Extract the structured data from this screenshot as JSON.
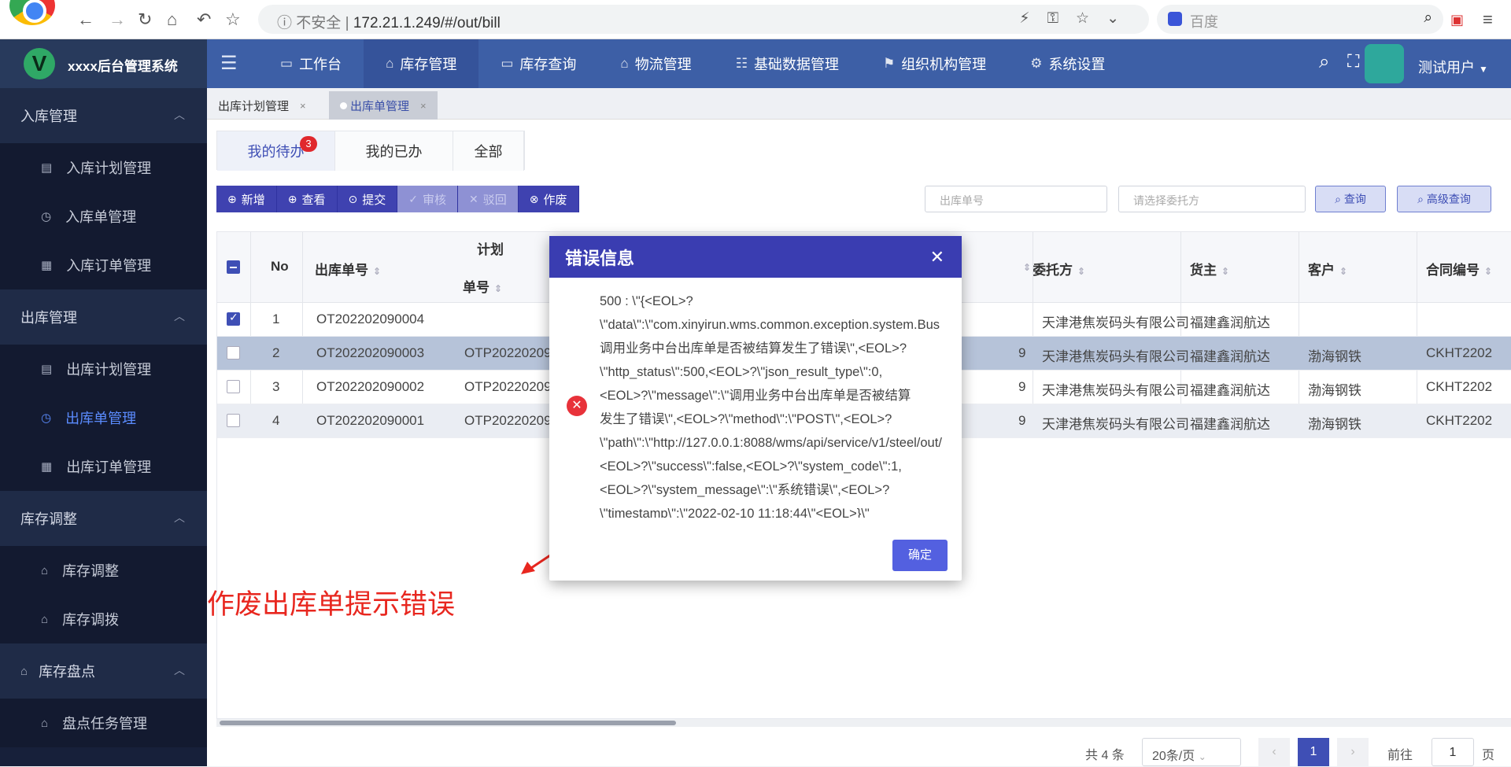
{
  "browser": {
    "security_label": "不安全",
    "url": "172.21.1.249/#/out/bill",
    "search_placeholder": "百度"
  },
  "app": {
    "brand_title": "xxxx后台管理系统",
    "nav": [
      {
        "label": "工作台"
      },
      {
        "label": "库存管理"
      },
      {
        "label": "库存查询"
      },
      {
        "label": "物流管理"
      },
      {
        "label": "基础数据管理"
      },
      {
        "label": "组织机构管理"
      },
      {
        "label": "系统设置"
      }
    ],
    "user_name": "测试用户"
  },
  "sidebar": {
    "groups": [
      {
        "label": "入库管理",
        "items": [
          {
            "label": "入库计划管理"
          },
          {
            "label": "入库单管理"
          },
          {
            "label": "入库订单管理"
          }
        ]
      },
      {
        "label": "出库管理",
        "items": [
          {
            "label": "出库计划管理"
          },
          {
            "label": "出库单管理"
          },
          {
            "label": "出库订单管理"
          }
        ]
      },
      {
        "label": "库存调整",
        "items": [
          {
            "label": "库存调整"
          },
          {
            "label": "库存调拨"
          }
        ]
      },
      {
        "label": "库存盘点",
        "items": [
          {
            "label": "盘点任务管理"
          }
        ]
      }
    ]
  },
  "tabs": [
    {
      "label": "出库计划管理"
    },
    {
      "label": "出库单管理"
    }
  ],
  "subtabs": [
    {
      "label": "我的待办",
      "badge": "3"
    },
    {
      "label": "我的已办"
    },
    {
      "label": "全部"
    }
  ],
  "toolbar": {
    "add": "新增",
    "view": "查看",
    "submit": "提交",
    "audit": "审核",
    "reject": "驳回",
    "void": "作废"
  },
  "filters": {
    "bill_no_placeholder": "出库单号",
    "consignor_placeholder": "请选择委托方",
    "query": "查询",
    "advanced_query": "高级查询"
  },
  "table": {
    "headers": {
      "no": "No",
      "bill_no": "出库单号",
      "plan_group": "计划",
      "plan_no": "单号",
      "consignor": "委托方",
      "owner": "货主",
      "customer": "客户",
      "contract": "合同编号"
    },
    "rows": [
      {
        "no": "1",
        "bill_no": "OT202202090004",
        "plan_no": "",
        "mid": "",
        "consignor": "天津港焦炭码头有限公司",
        "owner": "福建鑫润航达",
        "customer": "",
        "contract": ""
      },
      {
        "no": "2",
        "bill_no": "OT202202090003",
        "plan_no": "OTP20220209",
        "mid": "9",
        "consignor": "天津港焦炭码头有限公司",
        "owner": "福建鑫润航达",
        "customer": "渤海钢铁",
        "contract": "CKHT2202"
      },
      {
        "no": "3",
        "bill_no": "OT202202090002",
        "plan_no": "OTP20220209",
        "mid": "9",
        "consignor": "天津港焦炭码头有限公司",
        "owner": "福建鑫润航达",
        "customer": "渤海钢铁",
        "contract": "CKHT2202"
      },
      {
        "no": "4",
        "bill_no": "OT202202090001",
        "plan_no": "OTP20220209",
        "mid": "9",
        "consignor": "天津港焦炭码头有限公司",
        "owner": "福建鑫润航达",
        "customer": "渤海钢铁",
        "contract": "CKHT2202"
      }
    ]
  },
  "pager": {
    "total": "共 4 条",
    "page_size": "20条/页",
    "current_page": "1",
    "goto_label": "前往",
    "goto_value": "1",
    "page_suffix": "页"
  },
  "modal": {
    "title": "错误信息",
    "lines": [
      "500 : \\\"{<EOL>?",
      "\\\"data\\\":\\\"com.xinyirun.wms.common.exception.system.Bus",
      "调用业务中台出库单是否被结算发生了错误\\\",<EOL>?",
      "\\\"http_status\\\":500,<EOL>?\\\"json_result_type\\\":0,",
      "<EOL>?\\\"message\\\":\\\"调用业务中台出库单是否被结算",
      "发生了错误\\\",<EOL>?\\\"method\\\":\\\"POST\\\",<EOL>?",
      "\\\"path\\\":\\\"http://127.0.0.1:8088/wms/api/service/v1/steel/out/",
      "<EOL>?\\\"success\\\":false,<EOL>?\\\"system_code\\\":1,",
      "<EOL>?\\\"system_message\\\":\\\"系统错误\\\",<EOL>?",
      "\\\"timestamp\\\":\\\"2022-02-10 11:18:44\\\"<EOL>}\\\""
    ],
    "ok": "确定"
  },
  "annotation": "作废出库单提示错误",
  "colors": {
    "topnav": "#3d5fa6",
    "sidebar": "#17203a",
    "primary": "#3f4fb5",
    "error": "#e8323a",
    "annotation": "#e8271f"
  }
}
